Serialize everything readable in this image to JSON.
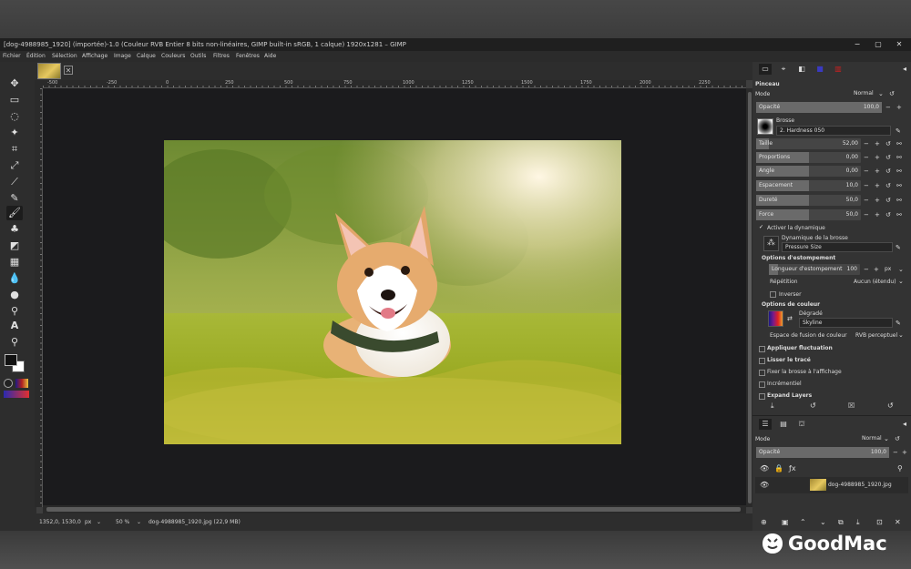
{
  "window": {
    "title": "[dog-4988985_1920] (importée)-1.0 (Couleur RVB Entier 8 bits non-linéaires, GIMP built-in sRGB, 1 calque) 1920x1281 – GIMP",
    "app_icon": "wilber-icon",
    "minimize": "−",
    "maximize": "▢",
    "close": "✕"
  },
  "menu": [
    "Fichier",
    "Édition",
    "Sélection",
    "Affichage",
    "Image",
    "Calque",
    "Couleurs",
    "Outils",
    "Filtres",
    "Fenêtres",
    "Aide"
  ],
  "rulers": {
    "h_labels": [
      "-500",
      "-250",
      "0",
      "250",
      "500",
      "750",
      "1000",
      "1250",
      "1500",
      "1750",
      "2000",
      "2250"
    ]
  },
  "status": {
    "coords": "1352,0, 1530,0",
    "unit": "px",
    "zoom": "50 %",
    "file": "dog-4988985_1920.jpg (22,9 MB)"
  },
  "tool_options": {
    "title": "Pinceau",
    "mode_label": "Mode",
    "mode_value": "Normal",
    "opacity": {
      "label": "Opacité",
      "value": "100,0",
      "fraction": 1.0
    },
    "brush_label": "Brosse",
    "brush_name": "2. Hardness 050",
    "sliders": [
      {
        "label": "Taille",
        "value": "52,00",
        "fraction": 0.12
      },
      {
        "label": "Proportions",
        "value": "0,00",
        "fraction": 0.5
      },
      {
        "label": "Angle",
        "value": "0,00",
        "fraction": 0.5
      },
      {
        "label": "Espacement",
        "value": "10,0",
        "fraction": 0.5
      },
      {
        "label": "Dureté",
        "value": "50,0",
        "fraction": 0.5
      },
      {
        "label": "Force",
        "value": "50,0",
        "fraction": 0.5
      }
    ],
    "dynamics_toggle": "Activer la dynamique",
    "dynamics_label": "Dynamique de la brosse",
    "dynamics_value": "Pressure Size",
    "fade_title": "Options d'estompement",
    "fade_length_label": "Longueur d'estompement",
    "fade_length_value": "100",
    "fade_unit": "px",
    "repeat_label": "Répétition",
    "repeat_value": "Aucun (étendu)",
    "reverse_label": "Inverser",
    "color_title": "Options de couleur",
    "gradient_label": "Dégradé",
    "gradient_value": "Skyline",
    "blend_space_label": "Espace de fusion de couleur",
    "blend_space_value": "RVB perceptuel",
    "jitter_label": "Appliquer fluctuation",
    "smooth_label": "Lisser le tracé",
    "lock_view_label": "Fixer la brosse à l'affichage",
    "incremental_label": "Incrémentiel",
    "expand_label": "Expand Layers"
  },
  "layers": {
    "mode_label": "Mode",
    "mode_value": "Normal",
    "opacity_label": "Opacité",
    "opacity_value": "100,0",
    "items": [
      {
        "name": "dog-4988985_1920.jpg",
        "visible": true
      }
    ]
  },
  "watermark": {
    "text": "GoodMac"
  },
  "colors": {
    "accent_fg": "#111111",
    "accent_bg": "#ffffff",
    "canvas_bg": "#1b1b1d"
  }
}
